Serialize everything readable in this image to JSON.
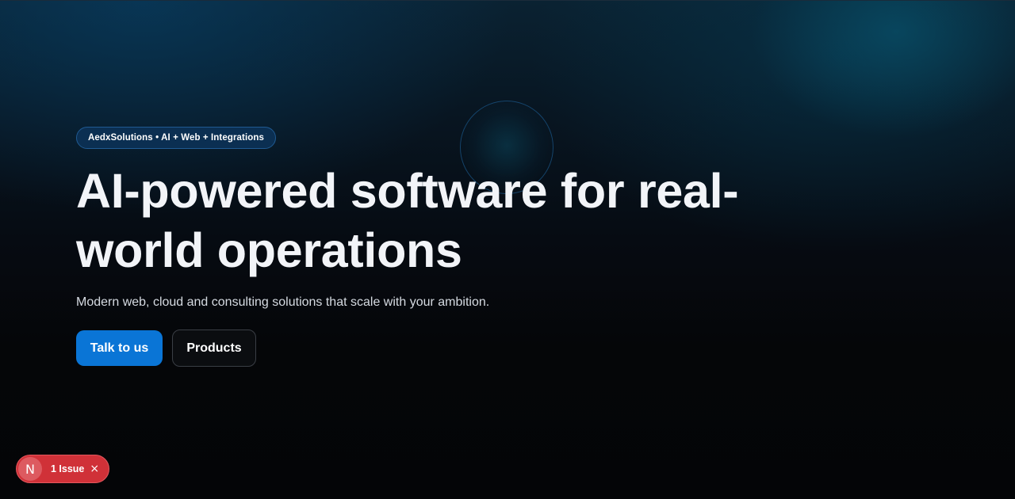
{
  "hero": {
    "badge": "AedxSolutions • AI + Web + Integrations",
    "headline_line1": "AI-powered software for real-",
    "headline_line2": "world operations",
    "subtitle": "Modern web, cloud and consulting solutions that scale with your ambition.",
    "primary_button": "Talk to us",
    "secondary_button": "Products"
  },
  "dev_overlay": {
    "logo_letter": "N",
    "issues_label": "1 Issue",
    "close_glyph": "×"
  },
  "colors": {
    "accent": "#0a75d6",
    "badge_bg": "#0b2f52",
    "issue_red": "#d03138",
    "background": "#050608"
  },
  "icons": {
    "dev_logo": "nextjs-n-icon",
    "close": "close-icon"
  }
}
